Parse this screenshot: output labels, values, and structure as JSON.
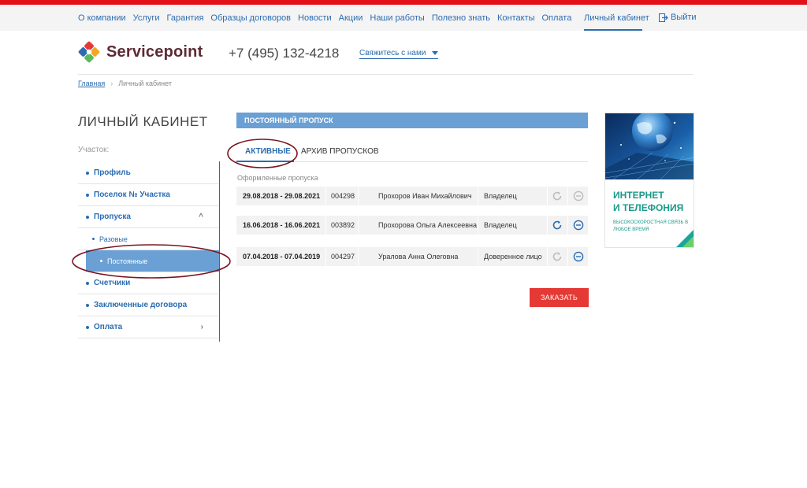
{
  "nav": {
    "links": [
      "О компании",
      "Услуги",
      "Гарантия",
      "Образцы договоров",
      "Новости",
      "Акции",
      "Наши работы",
      "Полезно знать",
      "Контакты",
      "Оплата"
    ],
    "cabinet": "Личный кабинет",
    "logout": "Выйти"
  },
  "header": {
    "brand": "Servicepoint",
    "phone": "+7 (495) 132-4218",
    "contact": "Свяжитесь с нами"
  },
  "breadcrumb": {
    "home": "Главная",
    "current": "Личный кабинет"
  },
  "sidebar": {
    "title": "ЛИЧНЫЙ КАБИНЕТ",
    "plot_label": "Участок:",
    "items": [
      {
        "label": "Профиль"
      },
      {
        "label": "Поселок № Участка"
      },
      {
        "label": "Пропуска",
        "chevron": "^"
      },
      {
        "label": "Разовые"
      },
      {
        "label": "Постоянные"
      },
      {
        "label": "Счетчики"
      },
      {
        "label": "Заключенные договора"
      },
      {
        "label": "Оплата",
        "chevron": "›"
      }
    ]
  },
  "main": {
    "section_title": "ПОСТОЯННЫЙ ПРОПУСК",
    "tabs": [
      "АКТИВНЫЕ",
      "АРХИВ ПРОПУСКОВ"
    ],
    "passes_label": "Оформленные пропуска",
    "passes": [
      {
        "dates": "29.08.2018 - 29.08.2021",
        "number": "004298",
        "name": "Прохоров Иван Михайлович",
        "role": "Владелец",
        "icons_active": false
      },
      {
        "dates": "16.06.2018 - 16.06.2021",
        "number": "003892",
        "name": "Прохорова Ольга Алексеевна",
        "role": "Владелец",
        "icons_active": true
      },
      {
        "dates": "07.04.2018 - 07.04.2019",
        "number": "004297",
        "name": "Уралова Анна Олеговна",
        "role": "Доверенное лицо",
        "icons_active": "mixed"
      }
    ],
    "order_button": "ЗАКАЗАТЬ"
  },
  "ad": {
    "title_line1": "ИНТЕРНЕТ",
    "title_line2": "И ТЕЛЕФОНИЯ",
    "subtitle": "ВЫСОКОСКОРОСТНАЯ СВЯЗЬ В ЛЮБОЕ ВРЕМЯ"
  },
  "colors": {
    "accent": "#2b6cb0",
    "header_bar": "#6aa0d4",
    "brand_red": "#e3101a",
    "order_button": "#e53935",
    "annotation": "#7a1420"
  }
}
